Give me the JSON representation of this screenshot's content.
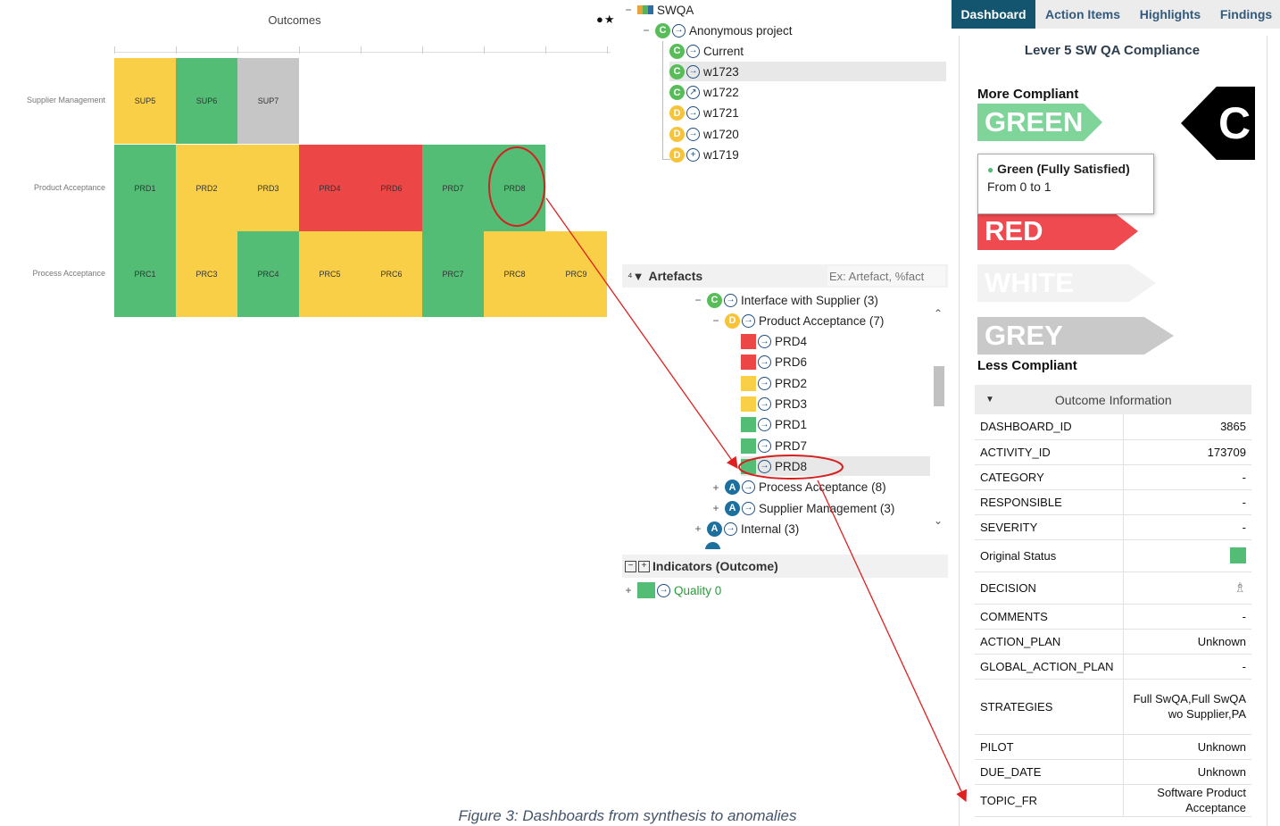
{
  "heatmap": {
    "title": "Outcomes",
    "icons": "●★",
    "rows": [
      {
        "label": "Supplier Management",
        "cells": [
          {
            "text": "SUP5",
            "color": "yellow"
          },
          {
            "text": "SUP6",
            "color": "green"
          },
          {
            "text": "SUP7",
            "color": "grey"
          }
        ]
      },
      {
        "label": "Product Acceptance",
        "cells": [
          {
            "text": "PRD1",
            "color": "green"
          },
          {
            "text": "PRD2",
            "color": "yellow"
          },
          {
            "text": "PRD3",
            "color": "yellow"
          },
          {
            "text": "PRD4",
            "color": "red"
          },
          {
            "text": "PRD6",
            "color": "red"
          },
          {
            "text": "PRD7",
            "color": "green"
          },
          {
            "text": "PRD8",
            "color": "green"
          }
        ]
      },
      {
        "label": "Process Acceptance",
        "cells": [
          {
            "text": "PRC1",
            "color": "green"
          },
          {
            "text": "PRC3",
            "color": "yellow"
          },
          {
            "text": "PRC4",
            "color": "green"
          },
          {
            "text": "PRC5",
            "color": "yellow"
          },
          {
            "text": "PRC6",
            "color": "yellow"
          },
          {
            "text": "PRC7",
            "color": "green"
          },
          {
            "text": "PRC8",
            "color": "yellow"
          },
          {
            "text": "PRC9",
            "color": "yellow"
          }
        ]
      }
    ]
  },
  "project_tree": {
    "root": "SWQA",
    "project": {
      "label": "Anonymous project",
      "badge": "C"
    },
    "versions": [
      {
        "label": "Current",
        "badge": "C",
        "arrow": "→"
      },
      {
        "label": "w1723",
        "badge": "C",
        "arrow": "→"
      },
      {
        "label": "w1722",
        "badge": "C",
        "arrow": "↗"
      },
      {
        "label": "w1721",
        "badge": "D",
        "arrow": "→"
      },
      {
        "label": "w1720",
        "badge": "D",
        "arrow": "→"
      },
      {
        "label": "w1719",
        "badge": "D",
        "arrow": "+"
      }
    ]
  },
  "artefacts": {
    "header": "Artefacts",
    "search_placeholder": "Ex: Artefact, %fact",
    "items": [
      {
        "label": "Interface with Supplier (3)",
        "badge": "C",
        "toggle": "−"
      },
      {
        "label": "Product Acceptance (7)",
        "badge": "D",
        "toggle": "−"
      },
      {
        "label": "PRD4",
        "status": "red"
      },
      {
        "label": "PRD6",
        "status": "red"
      },
      {
        "label": "PRD2",
        "status": "yellow"
      },
      {
        "label": "PRD3",
        "status": "yellow"
      },
      {
        "label": "PRD1",
        "status": "green"
      },
      {
        "label": "PRD7",
        "status": "green"
      },
      {
        "label": "PRD8",
        "status": "green"
      },
      {
        "label": "Process Acceptance (8)",
        "badge": "A",
        "toggle": "+"
      },
      {
        "label": "Supplier Management (3)",
        "badge": "A",
        "toggle": "+"
      },
      {
        "label": "Internal (3)",
        "badge": "A",
        "toggle": "+"
      }
    ]
  },
  "indicators": {
    "header": "Indicators (Outcome)",
    "item": "Quality 0"
  },
  "right_panel": {
    "tabs": [
      "Dashboard",
      "Action Items",
      "Highlights",
      "Findings"
    ],
    "compliance_title": "Lever 5 SW QA Compliance",
    "more_compliant": "More Compliant",
    "less_compliant": "Less Compliant",
    "scale": [
      {
        "label": "GREEN",
        "color": "#7fd49a"
      },
      {
        "label": "RED",
        "color": "#ef4a50"
      },
      {
        "label": "WHITE",
        "color": "#f2f2f2"
      },
      {
        "label": "GREY",
        "color": "#c9c9c9"
      }
    ],
    "rating_letter": "C",
    "tooltip": {
      "title": "Green (Fully Satisfied)",
      "range": "From 0 to 1"
    },
    "outcome_header": "Outcome Information",
    "info_rows": [
      {
        "key": "DASHBOARD_ID",
        "value": "3865"
      },
      {
        "key": "ACTIVITY_ID",
        "value": "173709"
      },
      {
        "key": "CATEGORY",
        "value": "-"
      },
      {
        "key": "RESPONSIBLE",
        "value": "-"
      },
      {
        "key": "SEVERITY",
        "value": "-"
      },
      {
        "key": "Original Status",
        "value": ""
      },
      {
        "key": "DECISION",
        "value": ""
      },
      {
        "key": "COMMENTS",
        "value": "-"
      },
      {
        "key": "ACTION_PLAN",
        "value": "Unknown"
      },
      {
        "key": "GLOBAL_ACTION_PLAN",
        "value": "-"
      },
      {
        "key": "STRATEGIES",
        "value": "Full SwQA,Full SwQA wo Supplier,PA"
      },
      {
        "key": "PILOT",
        "value": "Unknown"
      },
      {
        "key": "DUE_DATE",
        "value": "Unknown"
      },
      {
        "key": "TOPIC_FR",
        "value": "Software Product Acceptance"
      }
    ]
  },
  "caption": "Figure 3: Dashboards from synthesis to anomalies"
}
